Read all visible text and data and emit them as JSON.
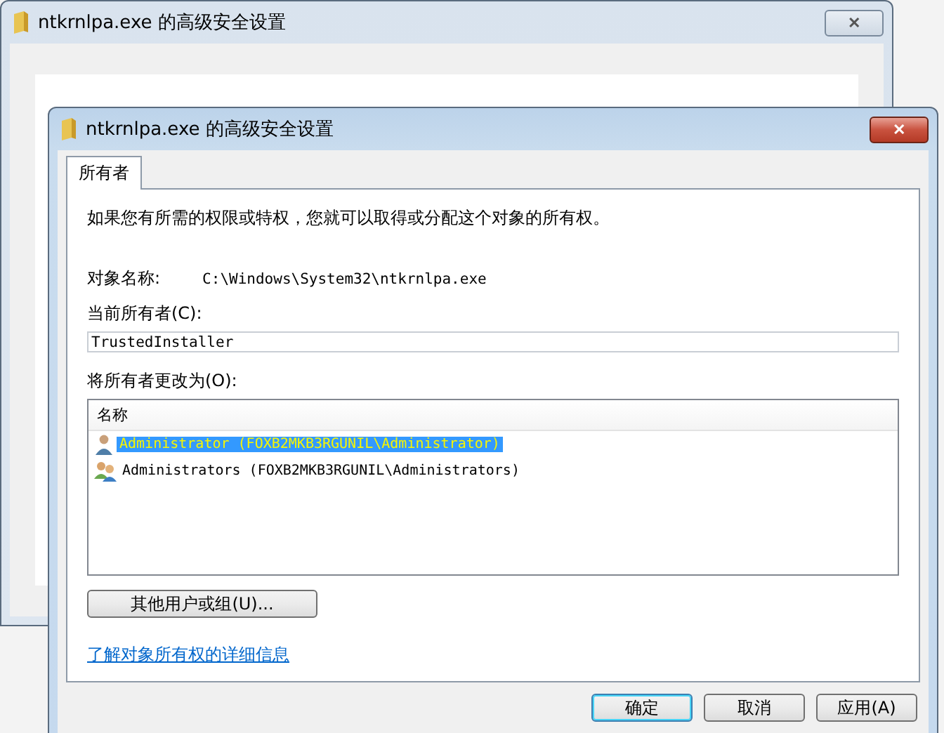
{
  "back_window": {
    "title": "ntkrnlpa.exe 的高级安全设置",
    "close": "✕"
  },
  "window": {
    "title": "ntkrnlpa.exe 的高级安全设置",
    "close": "✕"
  },
  "tabs": [
    {
      "label": "所有者",
      "selected": true
    }
  ],
  "intro": "如果您有所需的权限或特权，您就可以取得或分配这个对象的所有权。",
  "object_name": {
    "label": "对象名称:",
    "value": "C:\\Windows\\System32\\ntkrnlpa.exe"
  },
  "current_owner": {
    "label": "当前所有者(C):",
    "value": "TrustedInstaller"
  },
  "change_owner": {
    "label": "将所有者更改为(O):",
    "columns": [
      "名称"
    ],
    "rows": [
      {
        "kind": "user",
        "name": "Administrator (FOXB2MKB3RGUNIL\\Administrator)",
        "selected": true
      },
      {
        "kind": "group",
        "name": "Administrators (FOXB2MKB3RGUNIL\\Administrators)",
        "selected": false
      }
    ]
  },
  "other_users_button": "其他用户或组(U)...",
  "link": "了解对象所有权的详细信息",
  "buttons": [
    {
      "label": "确定",
      "default": true
    },
    {
      "label": "取消",
      "default": false
    },
    {
      "label": "应用(A)",
      "default": false
    }
  ]
}
